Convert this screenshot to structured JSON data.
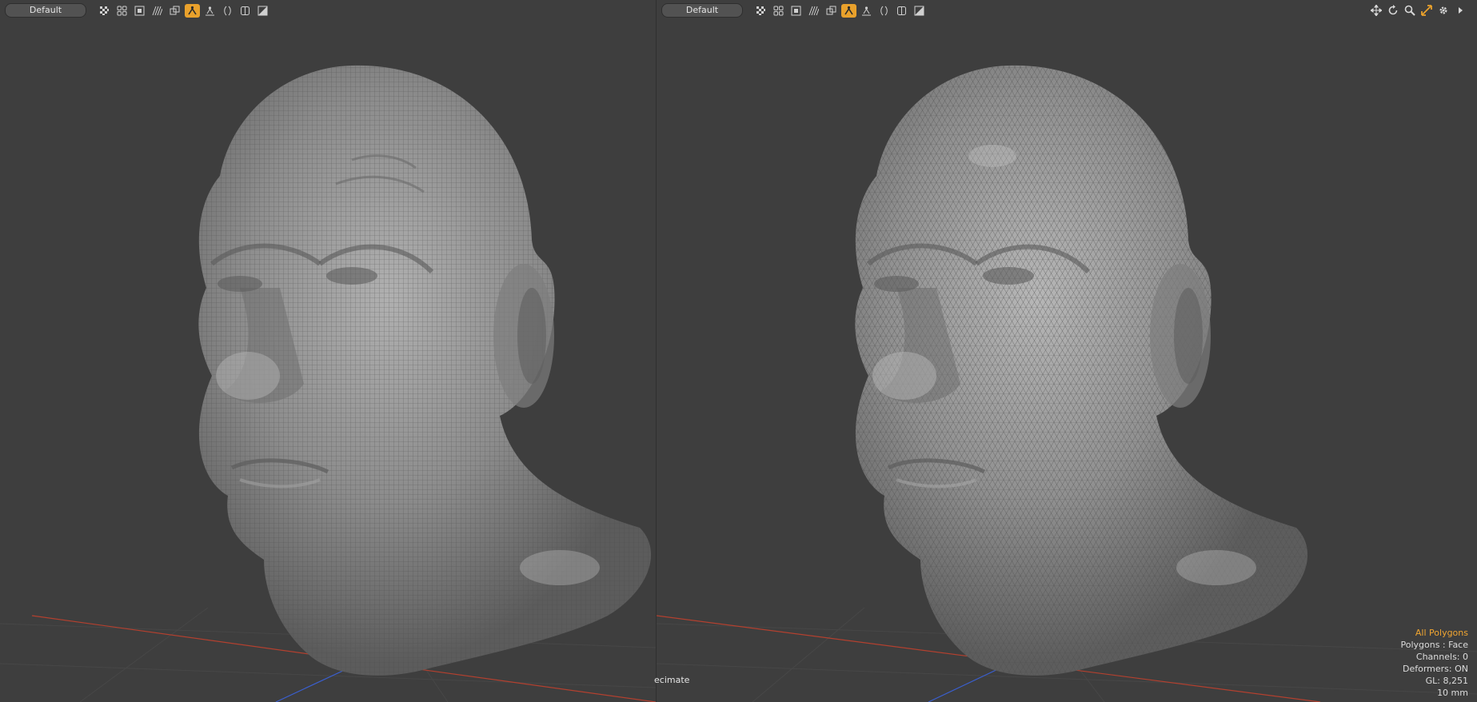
{
  "viewports": [
    {
      "preset_label": "Default",
      "mesh_style": "quad wireframe"
    },
    {
      "preset_label": "Default",
      "mesh_style": "decimated triangle wireframe"
    }
  ],
  "toolbar_icons": [
    {
      "name": "wireframe-checker-icon",
      "active": false
    },
    {
      "name": "grid-quad-icon",
      "active": false
    },
    {
      "name": "box-frame-icon",
      "active": false
    },
    {
      "name": "hatch-lines-icon",
      "active": false
    },
    {
      "name": "overlap-squares-icon",
      "active": false
    },
    {
      "name": "figure-icon",
      "active": true
    },
    {
      "name": "scene-figure-icon",
      "active": false
    },
    {
      "name": "slice-icon",
      "active": false
    },
    {
      "name": "double-slice-icon",
      "active": false
    },
    {
      "name": "gradient-square-icon",
      "active": false
    }
  ],
  "nav_tools": [
    "move-view-icon",
    "rotate-view-icon",
    "zoom-view-icon",
    "fit-view-icon",
    "settings-icon",
    "expand-arrow-icon"
  ],
  "action_label": "ecimate",
  "info_panel": {
    "selection": "All Polygons",
    "polygons": "Polygons : Face",
    "channels": "Channels: 0",
    "deformers": "Deformers: ON",
    "gl": "GL: 8,251",
    "unit": "10 mm"
  },
  "colors": {
    "background": "#3e3e3e",
    "accent": "#e9a12c",
    "x_axis": "#c0392b",
    "z_axis": "#3a5fd0",
    "mesh": "#8f8f8f"
  }
}
